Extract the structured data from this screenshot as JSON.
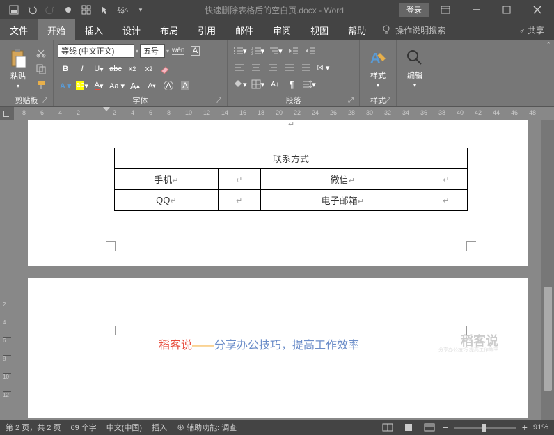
{
  "title": "快速删除表格后的空白页.docx - Word",
  "login": "登录",
  "menu": {
    "file": "文件",
    "home": "开始",
    "insert": "插入",
    "design": "设计",
    "layout": "布局",
    "references": "引用",
    "mailings": "邮件",
    "review": "审阅",
    "view": "视图",
    "help": "帮助",
    "search": "操作说明搜索"
  },
  "share": "共享",
  "ribbon": {
    "clipboard": {
      "label": "剪贴板",
      "paste": "粘贴"
    },
    "font": {
      "label": "字体",
      "name": "等线 (中文正文)",
      "size": "五号"
    },
    "paragraph": {
      "label": "段落"
    },
    "styles": {
      "label": "样式",
      "btn": "样式"
    },
    "editing": {
      "btn": "编辑"
    }
  },
  "ruler_ticks": [
    "8",
    "6",
    "4",
    "2",
    "",
    "2",
    "4",
    "6",
    "8",
    "10",
    "12",
    "14",
    "16",
    "18",
    "20",
    "22",
    "24",
    "26",
    "28",
    "30",
    "32",
    "34",
    "36",
    "38",
    "40",
    "42",
    "44",
    "46",
    "48"
  ],
  "table": {
    "header": "联系方式",
    "rows": [
      [
        "手机",
        "",
        "微信",
        ""
      ],
      [
        "QQ",
        "",
        "电子邮箱",
        ""
      ]
    ]
  },
  "page2": {
    "brand": "稻客说",
    "dash": "——",
    "slogan": "分享办公技巧，提高工作效率",
    "watermark": "稻客说",
    "wm_sub": "分享办公技巧 提高工作效率"
  },
  "status": {
    "page": "第 2 页，共 2 页",
    "words": "69 个字",
    "lang": "中文(中国)",
    "mode": "插入",
    "a11y": "辅助功能: 调查",
    "zoom": "91%"
  }
}
